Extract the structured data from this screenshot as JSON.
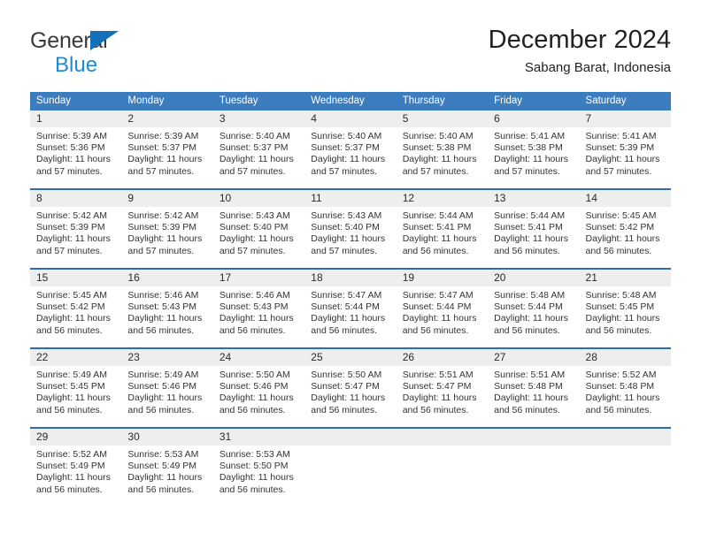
{
  "brand": {
    "name_part1": "General",
    "name_part2": "Blue"
  },
  "header": {
    "title": "December 2024",
    "subtitle": "Sabang Barat, Indonesia"
  },
  "colors": {
    "header_blue": "#3c7dc0",
    "week_border_blue": "#2d6cb0",
    "daynum_band": "#eeeeee",
    "brand_blue": "#1f8ad2",
    "logo_triangle": "#1271ba"
  },
  "weekday_headers": [
    "Sunday",
    "Monday",
    "Tuesday",
    "Wednesday",
    "Thursday",
    "Friday",
    "Saturday"
  ],
  "weeks": [
    [
      {
        "day": "1",
        "sunrise": "Sunrise: 5:39 AM",
        "sunset": "Sunset: 5:36 PM",
        "daylight_line1": "Daylight: 11 hours",
        "daylight_line2": "and 57 minutes."
      },
      {
        "day": "2",
        "sunrise": "Sunrise: 5:39 AM",
        "sunset": "Sunset: 5:37 PM",
        "daylight_line1": "Daylight: 11 hours",
        "daylight_line2": "and 57 minutes."
      },
      {
        "day": "3",
        "sunrise": "Sunrise: 5:40 AM",
        "sunset": "Sunset: 5:37 PM",
        "daylight_line1": "Daylight: 11 hours",
        "daylight_line2": "and 57 minutes."
      },
      {
        "day": "4",
        "sunrise": "Sunrise: 5:40 AM",
        "sunset": "Sunset: 5:37 PM",
        "daylight_line1": "Daylight: 11 hours",
        "daylight_line2": "and 57 minutes."
      },
      {
        "day": "5",
        "sunrise": "Sunrise: 5:40 AM",
        "sunset": "Sunset: 5:38 PM",
        "daylight_line1": "Daylight: 11 hours",
        "daylight_line2": "and 57 minutes."
      },
      {
        "day": "6",
        "sunrise": "Sunrise: 5:41 AM",
        "sunset": "Sunset: 5:38 PM",
        "daylight_line1": "Daylight: 11 hours",
        "daylight_line2": "and 57 minutes."
      },
      {
        "day": "7",
        "sunrise": "Sunrise: 5:41 AM",
        "sunset": "Sunset: 5:39 PM",
        "daylight_line1": "Daylight: 11 hours",
        "daylight_line2": "and 57 minutes."
      }
    ],
    [
      {
        "day": "8",
        "sunrise": "Sunrise: 5:42 AM",
        "sunset": "Sunset: 5:39 PM",
        "daylight_line1": "Daylight: 11 hours",
        "daylight_line2": "and 57 minutes."
      },
      {
        "day": "9",
        "sunrise": "Sunrise: 5:42 AM",
        "sunset": "Sunset: 5:39 PM",
        "daylight_line1": "Daylight: 11 hours",
        "daylight_line2": "and 57 minutes."
      },
      {
        "day": "10",
        "sunrise": "Sunrise: 5:43 AM",
        "sunset": "Sunset: 5:40 PM",
        "daylight_line1": "Daylight: 11 hours",
        "daylight_line2": "and 57 minutes."
      },
      {
        "day": "11",
        "sunrise": "Sunrise: 5:43 AM",
        "sunset": "Sunset: 5:40 PM",
        "daylight_line1": "Daylight: 11 hours",
        "daylight_line2": "and 57 minutes."
      },
      {
        "day": "12",
        "sunrise": "Sunrise: 5:44 AM",
        "sunset": "Sunset: 5:41 PM",
        "daylight_line1": "Daylight: 11 hours",
        "daylight_line2": "and 56 minutes."
      },
      {
        "day": "13",
        "sunrise": "Sunrise: 5:44 AM",
        "sunset": "Sunset: 5:41 PM",
        "daylight_line1": "Daylight: 11 hours",
        "daylight_line2": "and 56 minutes."
      },
      {
        "day": "14",
        "sunrise": "Sunrise: 5:45 AM",
        "sunset": "Sunset: 5:42 PM",
        "daylight_line1": "Daylight: 11 hours",
        "daylight_line2": "and 56 minutes."
      }
    ],
    [
      {
        "day": "15",
        "sunrise": "Sunrise: 5:45 AM",
        "sunset": "Sunset: 5:42 PM",
        "daylight_line1": "Daylight: 11 hours",
        "daylight_line2": "and 56 minutes."
      },
      {
        "day": "16",
        "sunrise": "Sunrise: 5:46 AM",
        "sunset": "Sunset: 5:43 PM",
        "daylight_line1": "Daylight: 11 hours",
        "daylight_line2": "and 56 minutes."
      },
      {
        "day": "17",
        "sunrise": "Sunrise: 5:46 AM",
        "sunset": "Sunset: 5:43 PM",
        "daylight_line1": "Daylight: 11 hours",
        "daylight_line2": "and 56 minutes."
      },
      {
        "day": "18",
        "sunrise": "Sunrise: 5:47 AM",
        "sunset": "Sunset: 5:44 PM",
        "daylight_line1": "Daylight: 11 hours",
        "daylight_line2": "and 56 minutes."
      },
      {
        "day": "19",
        "sunrise": "Sunrise: 5:47 AM",
        "sunset": "Sunset: 5:44 PM",
        "daylight_line1": "Daylight: 11 hours",
        "daylight_line2": "and 56 minutes."
      },
      {
        "day": "20",
        "sunrise": "Sunrise: 5:48 AM",
        "sunset": "Sunset: 5:44 PM",
        "daylight_line1": "Daylight: 11 hours",
        "daylight_line2": "and 56 minutes."
      },
      {
        "day": "21",
        "sunrise": "Sunrise: 5:48 AM",
        "sunset": "Sunset: 5:45 PM",
        "daylight_line1": "Daylight: 11 hours",
        "daylight_line2": "and 56 minutes."
      }
    ],
    [
      {
        "day": "22",
        "sunrise": "Sunrise: 5:49 AM",
        "sunset": "Sunset: 5:45 PM",
        "daylight_line1": "Daylight: 11 hours",
        "daylight_line2": "and 56 minutes."
      },
      {
        "day": "23",
        "sunrise": "Sunrise: 5:49 AM",
        "sunset": "Sunset: 5:46 PM",
        "daylight_line1": "Daylight: 11 hours",
        "daylight_line2": "and 56 minutes."
      },
      {
        "day": "24",
        "sunrise": "Sunrise: 5:50 AM",
        "sunset": "Sunset: 5:46 PM",
        "daylight_line1": "Daylight: 11 hours",
        "daylight_line2": "and 56 minutes."
      },
      {
        "day": "25",
        "sunrise": "Sunrise: 5:50 AM",
        "sunset": "Sunset: 5:47 PM",
        "daylight_line1": "Daylight: 11 hours",
        "daylight_line2": "and 56 minutes."
      },
      {
        "day": "26",
        "sunrise": "Sunrise: 5:51 AM",
        "sunset": "Sunset: 5:47 PM",
        "daylight_line1": "Daylight: 11 hours",
        "daylight_line2": "and 56 minutes."
      },
      {
        "day": "27",
        "sunrise": "Sunrise: 5:51 AM",
        "sunset": "Sunset: 5:48 PM",
        "daylight_line1": "Daylight: 11 hours",
        "daylight_line2": "and 56 minutes."
      },
      {
        "day": "28",
        "sunrise": "Sunrise: 5:52 AM",
        "sunset": "Sunset: 5:48 PM",
        "daylight_line1": "Daylight: 11 hours",
        "daylight_line2": "and 56 minutes."
      }
    ],
    [
      {
        "day": "29",
        "sunrise": "Sunrise: 5:52 AM",
        "sunset": "Sunset: 5:49 PM",
        "daylight_line1": "Daylight: 11 hours",
        "daylight_line2": "and 56 minutes."
      },
      {
        "day": "30",
        "sunrise": "Sunrise: 5:53 AM",
        "sunset": "Sunset: 5:49 PM",
        "daylight_line1": "Daylight: 11 hours",
        "daylight_line2": "and 56 minutes."
      },
      {
        "day": "31",
        "sunrise": "Sunrise: 5:53 AM",
        "sunset": "Sunset: 5:50 PM",
        "daylight_line1": "Daylight: 11 hours",
        "daylight_line2": "and 56 minutes."
      },
      {
        "day": "",
        "sunrise": "",
        "sunset": "",
        "daylight_line1": "",
        "daylight_line2": ""
      },
      {
        "day": "",
        "sunrise": "",
        "sunset": "",
        "daylight_line1": "",
        "daylight_line2": ""
      },
      {
        "day": "",
        "sunrise": "",
        "sunset": "",
        "daylight_line1": "",
        "daylight_line2": ""
      },
      {
        "day": "",
        "sunrise": "",
        "sunset": "",
        "daylight_line1": "",
        "daylight_line2": ""
      }
    ]
  ]
}
